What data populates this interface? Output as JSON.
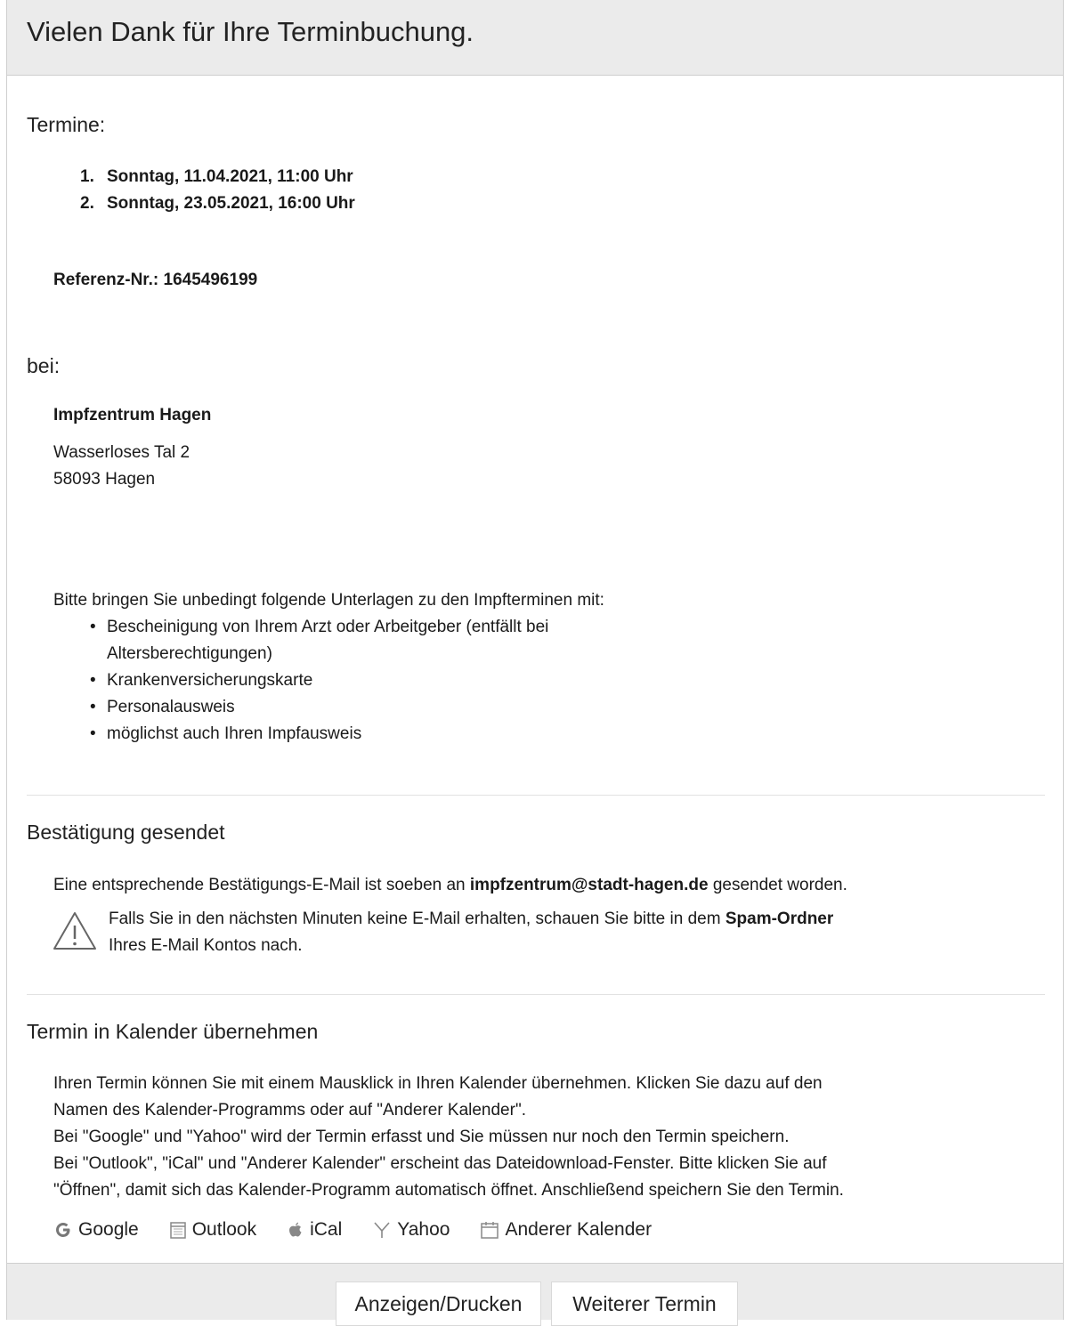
{
  "header": {
    "title": "Vielen Dank für Ihre Terminbuchung."
  },
  "appointments": {
    "label": "Termine:",
    "items": [
      {
        "num": "1.",
        "text": "Sonntag, 11.04.2021, 11:00 Uhr"
      },
      {
        "num": "2.",
        "text": "Sonntag, 23.05.2021, 16:00 Uhr"
      }
    ],
    "reference": "Referenz-Nr.: 1645496199"
  },
  "location": {
    "label": "bei:",
    "name": "Impfzentrum Hagen",
    "street": "Wasserloses Tal 2",
    "city": "58093 Hagen"
  },
  "documents": {
    "intro": "Bitte bringen Sie unbedingt folgende Unterlagen zu den Impfterminen mit:",
    "items": [
      "Bescheinigung von Ihrem Arzt oder Arbeitgeber (entfällt bei",
      "Altersberechtigungen)",
      "Krankenversicherungskarte",
      "Personalausweis",
      "möglichst auch Ihren Impfausweis"
    ]
  },
  "confirmation": {
    "heading": "Bestätigung gesendet",
    "text_before": "Eine entsprechende Bestätigungs-E-Mail ist soeben an ",
    "email": "impfzentrum@stadt-hagen.de",
    "text_after": " gesendet worden.",
    "warning_line1_before": "Falls Sie in den nächsten Minuten keine E-Mail erhalten, schauen Sie bitte in dem ",
    "warning_bold": "Spam-Ordner",
    "warning_line2": "Ihres E-Mail Kontos nach."
  },
  "calendar": {
    "heading": "Termin in Kalender übernehmen",
    "lines": [
      "Ihren Termin können Sie mit einem Mausklick in Ihren Kalender übernehmen. Klicken Sie dazu auf den",
      "Namen des Kalender-Programms oder auf \"Anderer Kalender\".",
      "Bei \"Google\" und \"Yahoo\" wird der Termin erfasst und Sie müssen nur noch den Termin speichern.",
      "Bei \"Outlook\", \"iCal\" und \"Anderer Kalender\" erscheint das Dateidownload-Fenster. Bitte klicken Sie auf",
      "\"Öffnen\", damit sich das Kalender-Programm automatisch öffnet. Anschließend speichern Sie den Termin."
    ],
    "links": {
      "google": "Google",
      "outlook": "Outlook",
      "ical": "iCal",
      "yahoo": "Yahoo",
      "other": "Anderer Kalender"
    }
  },
  "footer": {
    "show_print": "Anzeigen/Drucken",
    "next_appointment": "Weiterer Termin"
  }
}
